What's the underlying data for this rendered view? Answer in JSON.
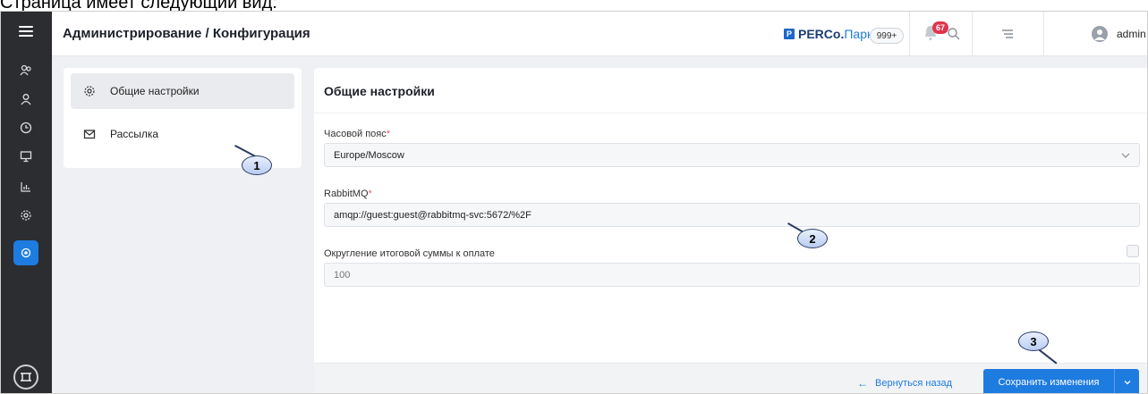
{
  "caption": "Страница имеет следующий вид:",
  "header": {
    "title": "Администрирование / Конфигурация",
    "brand_logo": "P",
    "brand_bold": "PERCo.",
    "brand_accent": "Паркинг",
    "count_badge": "999+",
    "notification_count": "67",
    "username": "admin"
  },
  "side_menu": {
    "items": [
      {
        "label": "Общие настройки",
        "icon": "gear-icon",
        "selected": true
      },
      {
        "label": "Рассылка",
        "icon": "mail-icon",
        "selected": false
      }
    ]
  },
  "main": {
    "title": "Общие настройки",
    "timezone": {
      "label": "Часовой пояс",
      "required_mark": "*",
      "value": "Europe/Moscow"
    },
    "rabbitmq": {
      "label": "RabbitMQ",
      "required_mark": "*",
      "value": "amqp://guest:guest@rabbitmq-svc:5672/%2F"
    },
    "rounding": {
      "label": "Округление итоговой суммы к оплате",
      "value": "100",
      "checked": false
    }
  },
  "footer": {
    "back_label": "Вернуться назад",
    "save_label": "Сохранить изменения"
  },
  "callouts": [
    "1",
    "2",
    "3"
  ],
  "colors": {
    "accent": "#1e7be0",
    "rail": "#2b2d31",
    "badge": "#e0344d"
  }
}
